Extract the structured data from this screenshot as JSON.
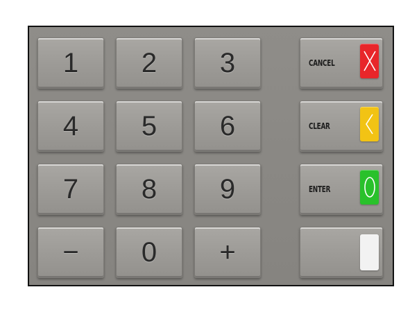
{
  "keypad": {
    "digits": [
      "1",
      "2",
      "3",
      "4",
      "5",
      "6",
      "7",
      "8",
      "9",
      "0"
    ],
    "minus_label": "−",
    "plus_label": "+"
  },
  "function_keys": {
    "cancel": {
      "label": "CANCEL",
      "color": "#e8262a",
      "icon": "x-icon"
    },
    "clear": {
      "label": "CLEAR",
      "color": "#f2c314",
      "icon": "chevron-left-icon"
    },
    "enter": {
      "label": "ENTER",
      "color": "#29c12b",
      "icon": "circle-icon"
    },
    "blank": {
      "label": "",
      "color": "#f2f2f2"
    }
  }
}
